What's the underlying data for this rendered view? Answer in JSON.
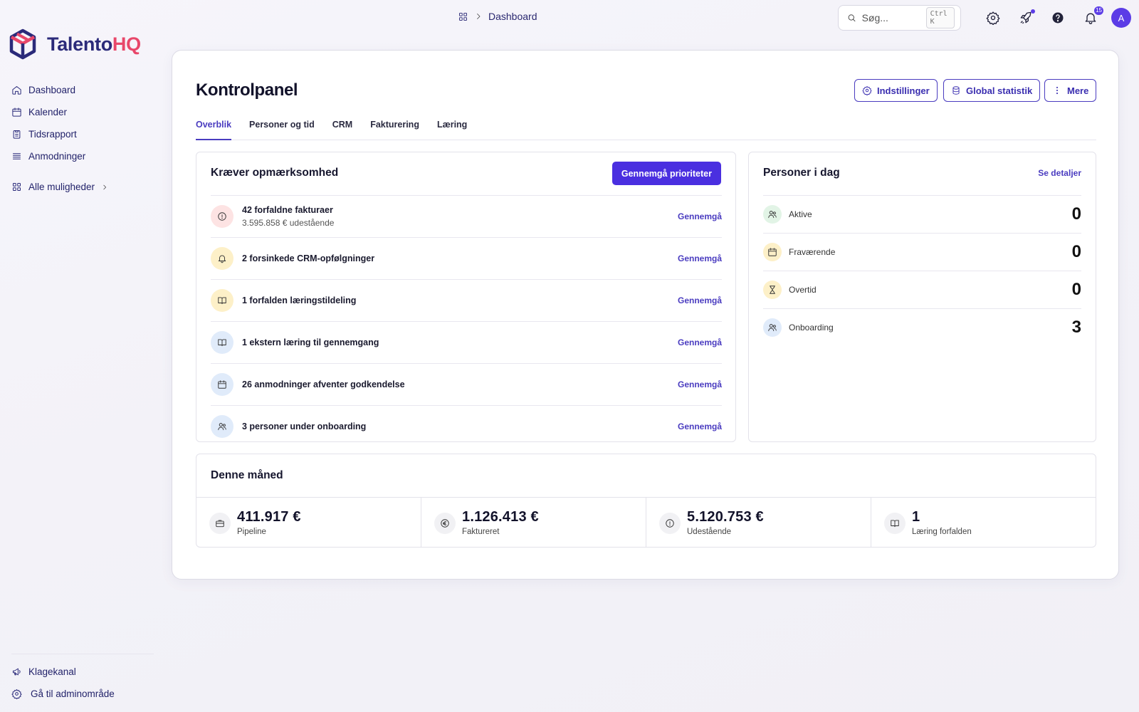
{
  "topbar": {
    "breadcrumb": "Dashboard",
    "search_placeholder": "Søg...",
    "search_shortcut": "Ctrl K",
    "notification_count": "15",
    "avatar_initial": "A"
  },
  "brand": {
    "name_part1": "Talento",
    "name_part2": "HQ",
    "primary_color": "#2b2a7a",
    "accent_color": "#e8476a"
  },
  "sidebar": {
    "items": [
      {
        "label": "Dashboard",
        "icon": "home-icon"
      },
      {
        "label": "Kalender",
        "icon": "calendar-icon"
      },
      {
        "label": "Tidsrapport",
        "icon": "clipboard-icon"
      },
      {
        "label": "Anmodninger",
        "icon": "list-icon"
      }
    ],
    "more_label": "Alle muligheder",
    "bottom": [
      {
        "label": "Klagekanal",
        "icon": "megaphone-icon"
      },
      {
        "label": "Gå til adminområde",
        "icon": "gear-icon"
      }
    ]
  },
  "page": {
    "title": "Kontrolpanel",
    "buttons": {
      "settings": "Indstillinger",
      "global_stats": "Global statistik",
      "more": "Mere"
    },
    "tabs": [
      "Overblik",
      "Personer og tid",
      "CRM",
      "Fakturering",
      "Læring"
    ],
    "active_tab": "Overblik",
    "accent_color": "#4a3cc0"
  },
  "attention": {
    "title": "Kræver opmærksomhed",
    "action": "Gennemgå prioriteter",
    "review_label": "Gennemgå",
    "items": [
      {
        "title": "42 forfaldne fakturaer",
        "subtitle": "3.595.858 € udestående",
        "icon": "alert-circle-icon",
        "tone": "red"
      },
      {
        "title": "2 forsinkede CRM-opfølgninger",
        "icon": "bell-icon",
        "tone": "yellow"
      },
      {
        "title": "1 forfalden læringstildeling",
        "icon": "book-icon",
        "tone": "yellow"
      },
      {
        "title": "1 ekstern læring til gennemgang",
        "icon": "book-icon",
        "tone": "blue"
      },
      {
        "title": "26 anmodninger afventer godkendelse",
        "icon": "calendar-icon",
        "tone": "blue"
      },
      {
        "title": "3 personer under onboarding",
        "icon": "users-icon",
        "tone": "blue"
      }
    ]
  },
  "people_today": {
    "title": "Personer i dag",
    "link": "Se detaljer",
    "rows": [
      {
        "label": "Aktive",
        "value": "0",
        "icon": "users-icon",
        "tone": "green"
      },
      {
        "label": "Fraværende",
        "value": "0",
        "icon": "calendar-icon",
        "tone": "yellow"
      },
      {
        "label": "Overtid",
        "value": "0",
        "icon": "hourglass-icon",
        "tone": "yellow"
      },
      {
        "label": "Onboarding",
        "value": "3",
        "icon": "users-icon",
        "tone": "blue"
      }
    ]
  },
  "this_month": {
    "title": "Denne måned",
    "stats": [
      {
        "value": "411.917 €",
        "label": "Pipeline",
        "icon": "briefcase-icon"
      },
      {
        "value": "1.126.413 €",
        "label": "Faktureret",
        "icon": "euro-icon"
      },
      {
        "value": "5.120.753 €",
        "label": "Udestående",
        "icon": "alert-circle-icon"
      },
      {
        "value": "1",
        "label": "Læring forfalden",
        "icon": "book-icon"
      }
    ]
  }
}
